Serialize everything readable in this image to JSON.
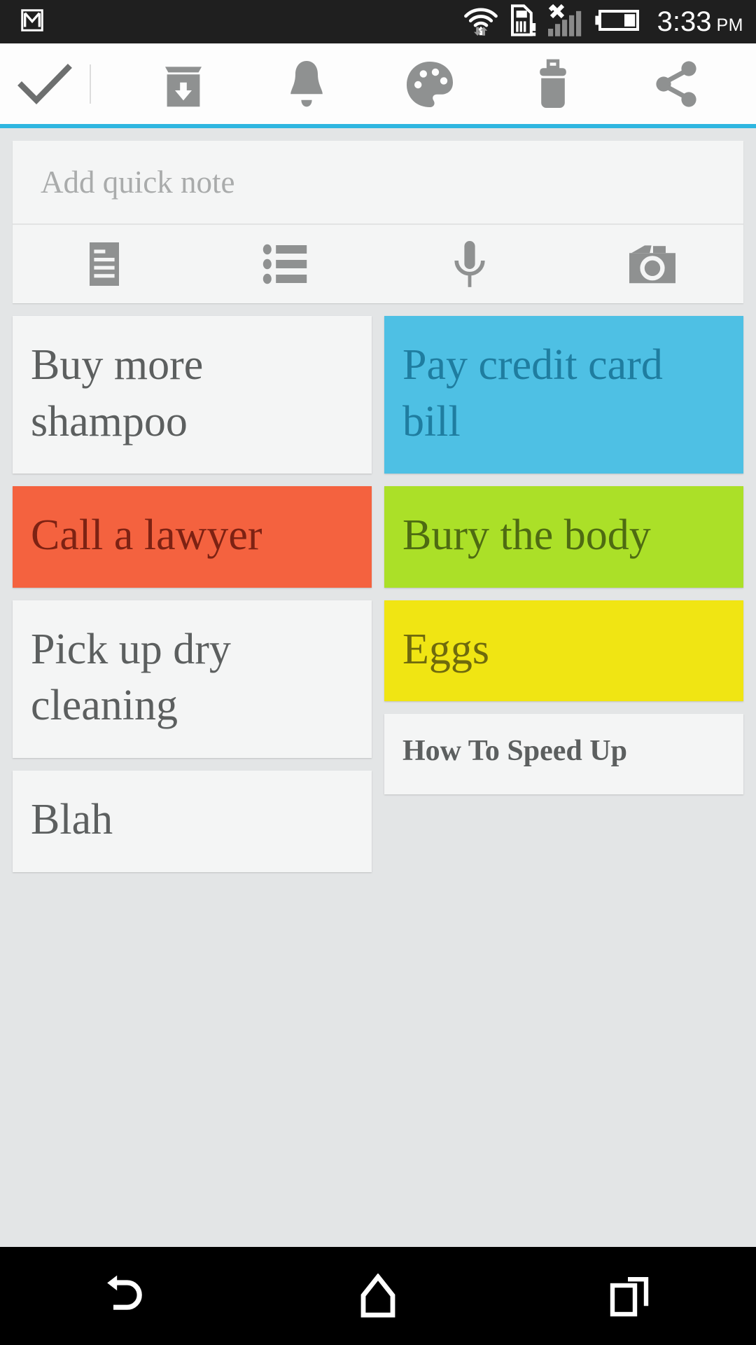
{
  "statusbar": {
    "time": "3:33",
    "ampm": "PM",
    "icons": [
      "gmail-icon",
      "wifi-icon",
      "sim-card-alert-icon",
      "no-signal-icon",
      "battery-icon"
    ]
  },
  "toolbar": {
    "done_label": "done-check",
    "actions": [
      "archive",
      "reminder",
      "color",
      "delete",
      "share"
    ]
  },
  "accent_color": "#2fb6e0",
  "quicknote": {
    "placeholder": "Add quick note",
    "actions": [
      "text-note",
      "list-note",
      "voice-note",
      "photo-note"
    ]
  },
  "notes": {
    "left": [
      {
        "text": "Buy more shampoo",
        "bg": "#f4f5f5",
        "fg": "#5c5f5f",
        "bold": false
      },
      {
        "text": "Call a lawyer",
        "bg": "#f4623f",
        "fg": "#7d2213",
        "bold": false
      },
      {
        "text": "Pick up dry cleaning",
        "bg": "#f4f5f5",
        "fg": "#5c5f5f",
        "bold": false
      },
      {
        "text": "Blah",
        "bg": "#f4f5f5",
        "fg": "#5c5f5f",
        "bold": false
      }
    ],
    "right": [
      {
        "text": "Pay credit card bill",
        "bg": "#4ec0e4",
        "fg": "#1f7da0",
        "bold": false
      },
      {
        "text": "Bury the body",
        "bg": "#abe028",
        "fg": "#4e6b12",
        "bold": false
      },
      {
        "text": "Eggs",
        "bg": "#f0e513",
        "fg": "#6f6a0d",
        "bold": false
      },
      {
        "text": "How To Speed Up",
        "bg": "#f4f5f5",
        "fg": "#5c5f5f",
        "bold": true
      }
    ]
  },
  "navbar": {
    "buttons": [
      "back-icon",
      "home-icon",
      "recents-icon"
    ]
  }
}
